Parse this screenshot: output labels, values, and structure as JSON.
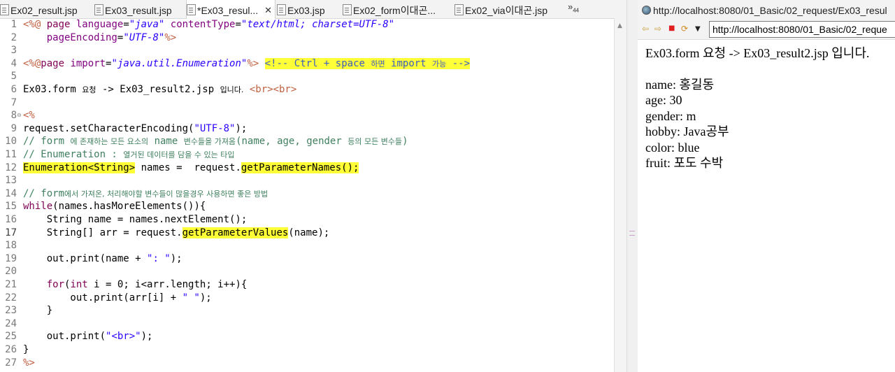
{
  "editor": {
    "tabs": [
      {
        "label": "Ex02_result.jsp",
        "active": false
      },
      {
        "label": "Ex03_result.jsp",
        "active": false
      },
      {
        "label": "*Ex03_resul...",
        "active": true
      },
      {
        "label": "Ex03.jsp",
        "active": false
      },
      {
        "label": "Ex02_form이대곤...",
        "active": false
      },
      {
        "label": "Ex02_via이대곤.jsp",
        "active": false
      }
    ],
    "tab_close": "✕",
    "tab_overflow": "»",
    "tab_overflow_count": "44",
    "line_numbers": [
      "1",
      "2",
      "3",
      "4",
      "5",
      "6",
      "7",
      "8",
      "9",
      "10",
      "11",
      "12",
      "13",
      "14",
      "15",
      "16",
      "17",
      "18",
      "19",
      "20",
      "21",
      "22",
      "23",
      "24",
      "25",
      "26",
      "27"
    ],
    "current_line": "17",
    "code": {
      "l1_open": "<%@ ",
      "l1_page": "page",
      "l1_language": "language",
      "l1_eq1": "=",
      "l1_java": "\"java\"",
      "l1_contentType": "contentType",
      "l1_eq2": "=",
      "l1_ct_val": "\"text/html; charset=UTF-8\"",
      "l2_indent": "    ",
      "l2_pageEncoding": "pageEncoding",
      "l2_eq": "=",
      "l2_val": "\"UTF-8\"",
      "l2_close": "%>",
      "l4_open": "<%@",
      "l4_page": "page",
      "l4_import": " import",
      "l4_eq": "=",
      "l4_val": "\"java.util.Enumeration\"",
      "l4_close": "%>",
      "l4_space": " ",
      "l4_comment_a": "<!-- Ctrl + space ",
      "l4_comment_kr": "하면",
      "l4_comment_b": " import ",
      "l4_comment_kr2": "가능",
      "l4_comment_c": " -->",
      "l6_text_a": "Ex03.form ",
      "l6_text_kr": "요청",
      "l6_text_b": " -> Ex03_result2.jsp ",
      "l6_text_kr2": "입니다.",
      "l6_space": " ",
      "l6_br": "<br><br>",
      "l8_open": "<%",
      "l9": "request.setCharacterEncoding(",
      "l9_str": "\"UTF-8\"",
      "l9_end": ");",
      "l10_a": "// form ",
      "l10_kr1": "에 존재하는 모든 요소의",
      "l10_b": " name ",
      "l10_kr2": "변수들을 가져옴",
      "l10_c": "(name, age, gender ",
      "l10_kr3": "등의 모든 변수들",
      "l10_d": ")",
      "l11_a": "// Enumeration : ",
      "l11_kr": "열거된 데이터를 담을 수 있는 타입",
      "l12_hl": "Enumeration<String>",
      "l12_mid": " names =  request.",
      "l12_hl2": "getParameterNames();",
      "l14_a": "// form",
      "l14_kr": "에서 가져온, 처리해야할 변수들이 많을경우 사용하면 좋은 방법",
      "l15_kw": "while",
      "l15_rest": "(names.hasMoreElements()){",
      "l16": "    String name = names.nextElement();",
      "l17_a": "    String[] arr = request.",
      "l17_hl": "getParameterValues",
      "l17_b": "(name);",
      "l19_a": "    out.print(name + ",
      "l19_str": "\": \"",
      "l19_b": ");",
      "l21_indent": "    ",
      "l21_for": "for",
      "l21_paren": "(",
      "l21_int": "int",
      "l21_rest": " i = 0; i<arr.length; i++){",
      "l22_a": "        out.print(arr[i] + ",
      "l22_str": "\" \"",
      "l22_b": ");",
      "l23": "    }",
      "l25_a": "    out.print(",
      "l25_str": "\"<br>\"",
      "l25_b": ");",
      "l26": "}",
      "l27": "%>"
    }
  },
  "browser": {
    "title": "http://localhost:8080/01_Basic/02_request/Ex03_resul",
    "url": "http://localhost:8080/01_Basic/02_reque",
    "nav": {
      "back": "⇦",
      "forward": "⇨",
      "stop": "■",
      "refresh": "⟳",
      "menu": "▼"
    },
    "content": {
      "heading": "Ex03.form 요청 -> Ex03_result2.jsp 입니다.",
      "rows": [
        "name: 홍길동",
        "age: 30",
        "gender: m",
        "hobby: Java공부",
        "color: blue",
        "fruit: 포도 수박"
      ]
    }
  }
}
